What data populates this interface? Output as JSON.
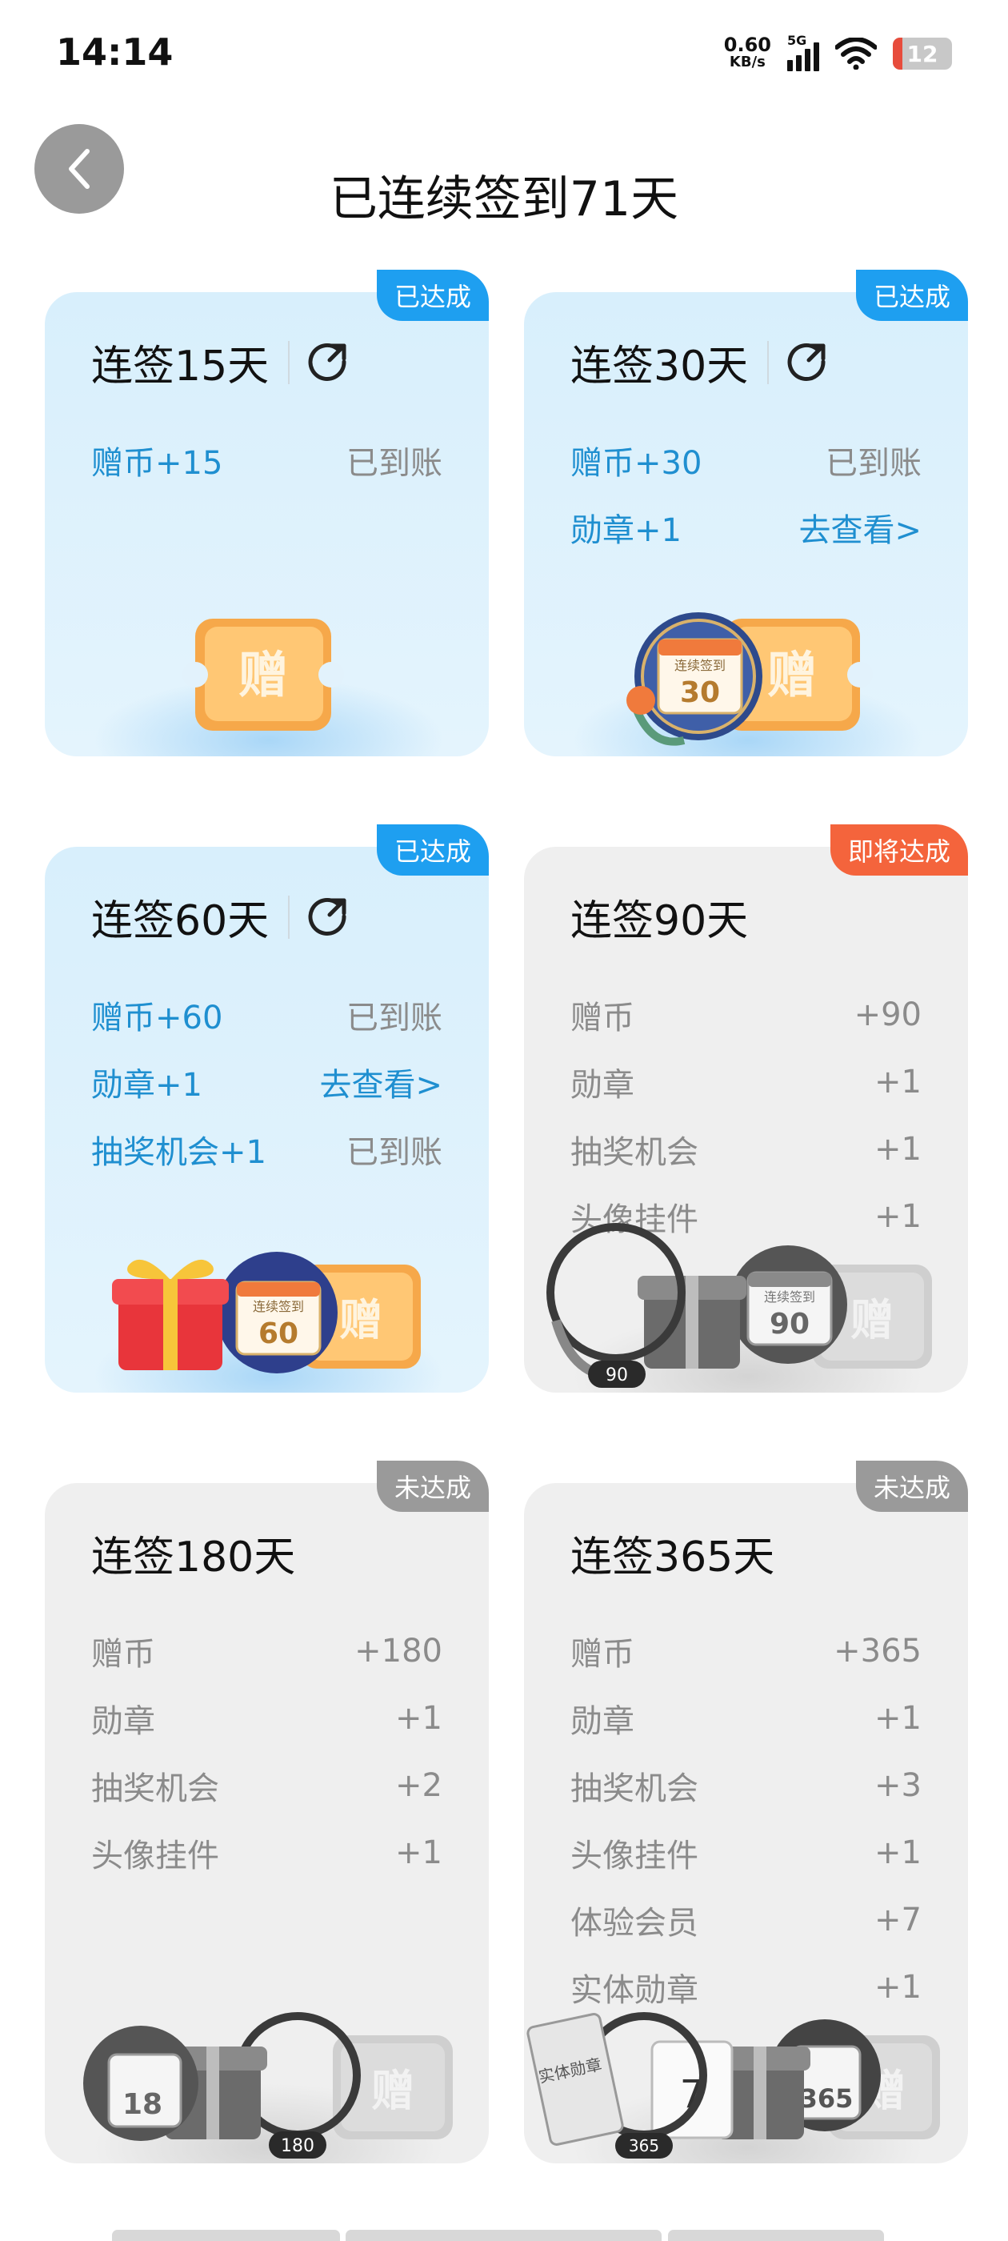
{
  "status_bar": {
    "time": "14:14",
    "net_speed_value": "0.60",
    "net_speed_unit": "KB/s",
    "network": "5G",
    "battery": "12"
  },
  "header": {
    "title": "已连续签到71天"
  },
  "cards": [
    {
      "title": "连签15天",
      "tag": "已达成",
      "rows": [
        {
          "label": "赠币+15",
          "value": "已到账"
        }
      ]
    },
    {
      "title": "连签30天",
      "tag": "已达成",
      "rows": [
        {
          "label": "赠币+30",
          "value": "已到账"
        },
        {
          "label": "勋章+1",
          "value": "去查看>"
        }
      ],
      "badge_text": "连续签到",
      "badge_num": "30"
    },
    {
      "title": "连签60天",
      "tag": "已达成",
      "rows": [
        {
          "label": "赠币+60",
          "value": "已到账"
        },
        {
          "label": "勋章+1",
          "value": "去查看>"
        },
        {
          "label": "抽奖机会+1",
          "value": "已到账"
        }
      ],
      "badge_text": "连续签到",
      "badge_num": "60"
    },
    {
      "title": "连签90天",
      "tag": "即将达成",
      "rows": [
        {
          "label": "赠币",
          "value": "+90"
        },
        {
          "label": "勋章",
          "value": "+1"
        },
        {
          "label": "抽奖机会",
          "value": "+1"
        },
        {
          "label": "头像挂件",
          "value": "+1"
        }
      ],
      "badge_text": "连续签到",
      "badge_num": "90",
      "frame_num": "90"
    },
    {
      "title": "连签180天",
      "tag": "未达成",
      "rows": [
        {
          "label": "赠币",
          "value": "+180"
        },
        {
          "label": "勋章",
          "value": "+1"
        },
        {
          "label": "抽奖机会",
          "value": "+2"
        },
        {
          "label": "头像挂件",
          "value": "+1"
        }
      ],
      "badge_num": "18",
      "frame_num": "180"
    },
    {
      "title": "连签365天",
      "tag": "未达成",
      "rows": [
        {
          "label": "赠币",
          "value": "+365"
        },
        {
          "label": "勋章",
          "value": "+1"
        },
        {
          "label": "抽奖机会",
          "value": "+3"
        },
        {
          "label": "头像挂件",
          "value": "+1"
        },
        {
          "label": "体验会员",
          "value": "+7"
        },
        {
          "label": "实体勋章",
          "value": "+1"
        }
      ],
      "badge_num": "365",
      "frame_num": "365",
      "vip_num": "7",
      "physical_badge_text": "实体勋章"
    }
  ],
  "gift_label": "赠",
  "colors": {
    "accent_blue": "#1e9ff0",
    "link_blue": "#1f8fd0",
    "tag_orange": "#f4643c",
    "tag_grey": "#9a9a9a"
  }
}
